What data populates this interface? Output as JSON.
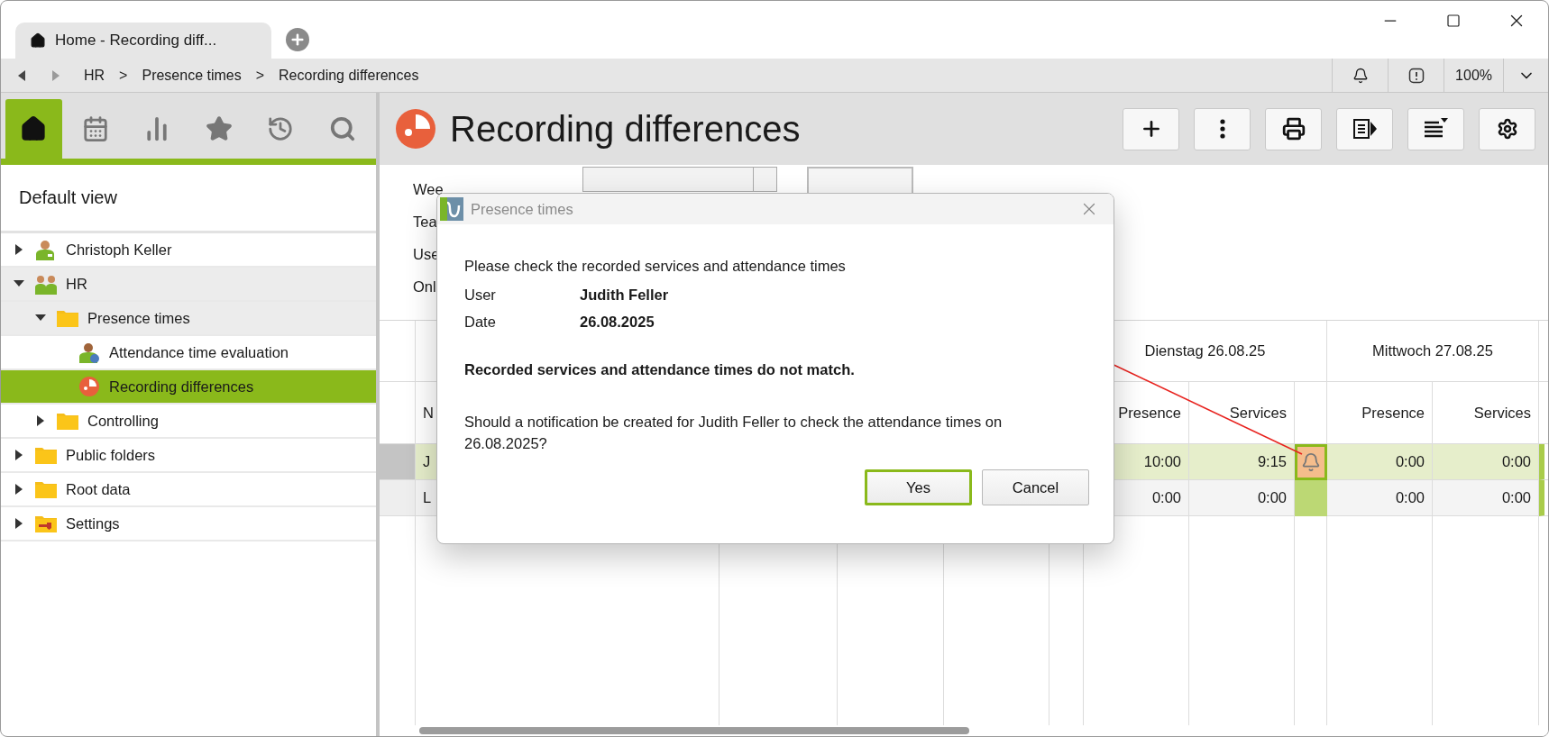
{
  "window": {
    "tab_title": "Home - Recording diff..."
  },
  "breadcrumb": [
    {
      "label": "HR"
    },
    {
      "separator": ">",
      "label": "Presence times"
    },
    {
      "separator": ">",
      "label": "Recording differences"
    }
  ],
  "zoom": "100%",
  "sidebar": {
    "tabs": [
      {
        "kind": "home",
        "selected": true
      },
      {
        "kind": "calendar",
        "selected": false
      },
      {
        "kind": "chart",
        "selected": false
      },
      {
        "kind": "star",
        "selected": false
      },
      {
        "kind": "history",
        "selected": false
      },
      {
        "kind": "search",
        "selected": false
      }
    ],
    "view_title": "Default view",
    "tree": [
      {
        "label": "Christoph Keller",
        "kind": "person",
        "expanded": false,
        "selected": false
      },
      {
        "label": "HR",
        "kind": "group",
        "expanded": true,
        "selected": false,
        "children": [
          {
            "label": "Presence times",
            "kind": "folder",
            "expanded": true,
            "selected": false,
            "children": [
              {
                "label": "Attendance time evaluation",
                "kind": "evaluation",
                "selected": false
              },
              {
                "label": "Recording differences",
                "kind": "report",
                "selected": true
              }
            ]
          },
          {
            "label": "Controlling",
            "kind": "folder",
            "expanded": false,
            "selected": false
          }
        ]
      },
      {
        "label": "Public folders",
        "kind": "folder",
        "expanded": false,
        "selected": false
      },
      {
        "label": "Root data",
        "kind": "folder",
        "expanded": false,
        "selected": false
      },
      {
        "label": "Settings",
        "kind": "settings",
        "expanded": false,
        "selected": false
      }
    ]
  },
  "page": {
    "title": "Recording differences",
    "toolbar": [
      {
        "kind": "add"
      },
      {
        "kind": "more"
      },
      {
        "kind": "print"
      },
      {
        "kind": "export"
      },
      {
        "kind": "list"
      },
      {
        "kind": "settings"
      }
    ]
  },
  "filters": [
    {
      "label": "Wee"
    },
    {
      "label": "Tea"
    },
    {
      "label": "Use"
    },
    {
      "label": "Onl"
    }
  ],
  "table": {
    "name_header": "N",
    "days": [
      {
        "label": "Dienstag 26.08.25",
        "presence_header": "Presence",
        "services_header": "Services"
      },
      {
        "label": "Mittwoch 27.08.25",
        "presence_header": "Presence",
        "services_header": "Services"
      }
    ],
    "rows": [
      {
        "name": "J",
        "selected": true,
        "days": [
          {
            "presence": "10:00",
            "services": "9:15",
            "alert": true
          },
          {
            "presence": "0:00",
            "services": "0:00"
          }
        ]
      },
      {
        "name": "L",
        "selected": false,
        "days": [
          {
            "presence": "0:00",
            "services": "0:00",
            "alert": false
          },
          {
            "presence": "0:00",
            "services": "0:00"
          }
        ]
      }
    ]
  },
  "dialog": {
    "title": "Presence times",
    "intro": "Please check the recorded services and attendance times",
    "fields": [
      {
        "label": "User",
        "value": "Judith Feller"
      },
      {
        "label": "Date",
        "value": "26.08.2025"
      }
    ],
    "warning": "Recorded services and attendance times do not match.",
    "question": "Should a notification be created for Judith Feller to check the attendance times on 26.08.2025?",
    "buttons": [
      {
        "label": "Yes",
        "default": true
      },
      {
        "label": "Cancel",
        "default": false
      }
    ]
  }
}
